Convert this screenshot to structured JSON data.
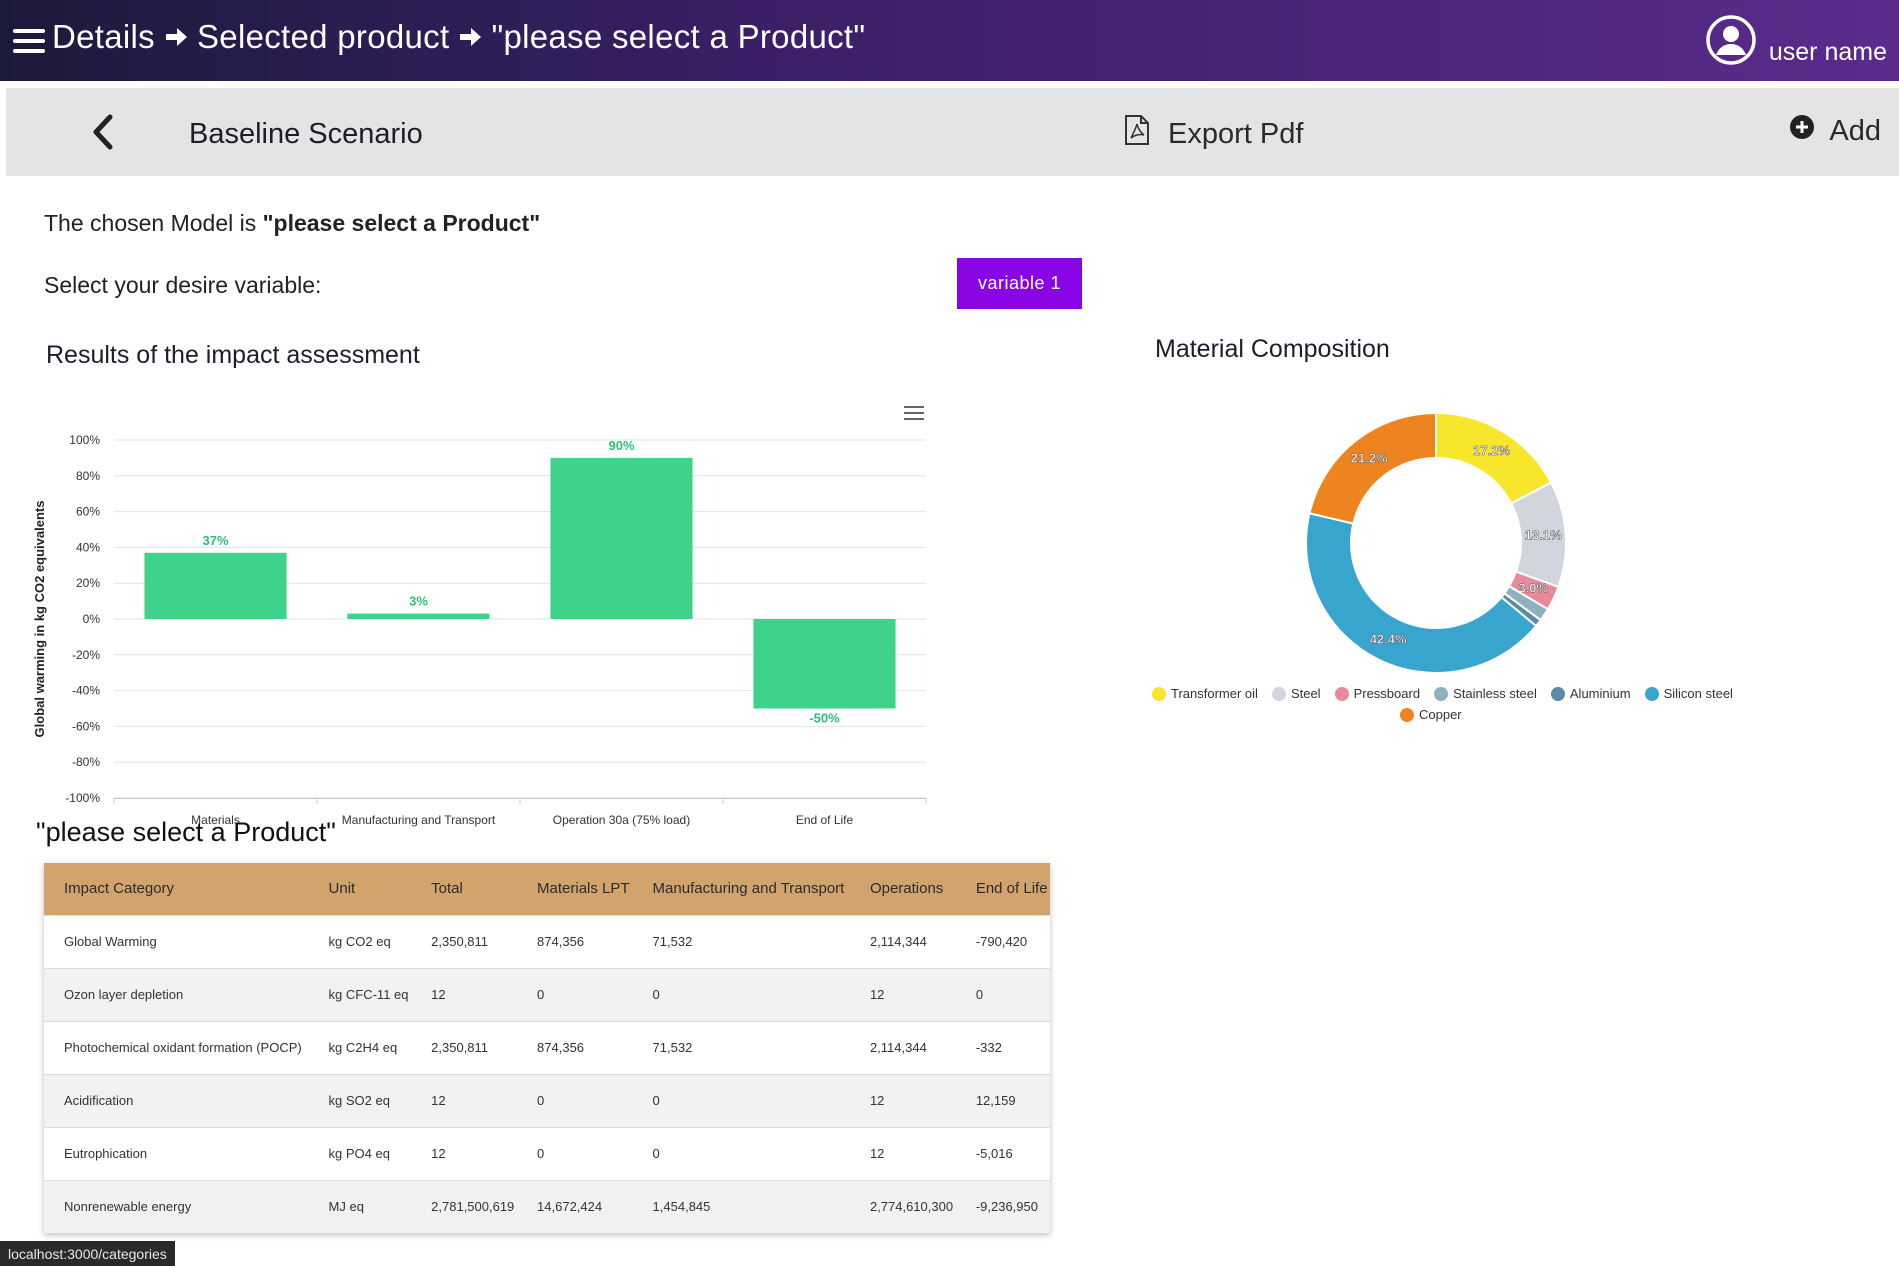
{
  "header": {
    "breadcrumbs": [
      "Details",
      "Selected product",
      "\"please select a Product\""
    ],
    "user_name": "user name"
  },
  "toolbar": {
    "title": "Baseline Scenario",
    "export_label": "Export Pdf",
    "add_label": "Add"
  },
  "content": {
    "model_prefix": "The chosen Model is ",
    "model_value": "\"please select a Product\"",
    "select_label": "Select your desire variable:",
    "variable_button": "variable 1",
    "impact_title": "Results of the impact assessment",
    "material_title": "Material Composition",
    "product_title": "\"please select a Product\""
  },
  "chart_data": [
    {
      "type": "bar",
      "title": "Results of the impact assessment",
      "ylabel": "Global warming in kg CO2 equivalents",
      "xlabel": "",
      "categories": [
        "Materials",
        "Manufacturing and Transport",
        "Operation 30a (75% load)",
        "End of Life"
      ],
      "values": [
        37,
        3,
        90,
        -50
      ],
      "data_labels": [
        "37%",
        "3%",
        "90%",
        "-50%"
      ],
      "ylim": [
        -100,
        100
      ],
      "yticks": [
        "100%",
        "80%",
        "60%",
        "40%",
        "20%",
        "0%",
        "-20%",
        "-40%",
        "-60%",
        "-80%",
        "-100%"
      ],
      "grid": true,
      "color": "#3fd28b"
    },
    {
      "type": "pie",
      "title": "Material Composition",
      "donut": true,
      "series": [
        {
          "name": "Transformer oil",
          "value": 17.2,
          "label": "17.2%",
          "color": "#f7e62b"
        },
        {
          "name": "Steel",
          "value": 13.1,
          "label": "13.1%",
          "color": "#d2d5de"
        },
        {
          "name": "Pressboard",
          "value": 3.0,
          "label": "3.0%",
          "color": "#e88a9a"
        },
        {
          "name": "Stainless steel",
          "value": 1.6,
          "label": "",
          "color": "#8fb0bd"
        },
        {
          "name": "Aluminium",
          "value": 0.9,
          "label": "",
          "color": "#5d88a6"
        },
        {
          "name": "Silicon steel",
          "value": 42.4,
          "label": "42.4%",
          "color": "#37a5cd"
        },
        {
          "name": "Copper",
          "value": 21.2,
          "label": "21.2%",
          "color": "#ee8420"
        }
      ],
      "legend_placement": "bottom"
    }
  ],
  "table": {
    "headers": [
      "Impact Category",
      "Unit",
      "Total",
      "Materials LPT",
      "Manufacturing and Transport",
      "Operations",
      "End of Life"
    ],
    "rows": [
      [
        "Global Warming",
        "kg CO2 eq",
        "2,350,811",
        "874,356",
        "71,532",
        "2,114,344",
        "-790,420"
      ],
      [
        "Ozon layer depletion",
        "kg CFC-11 eq",
        "12",
        "0",
        "0",
        "12",
        "0"
      ],
      [
        "Photochemical oxidant formation (POCP)",
        "kg C2H4 eq",
        "2,350,811",
        "874,356",
        "71,532",
        "2,114,344",
        "-332"
      ],
      [
        "Acidification",
        "kg SO2 eq",
        "12",
        "0",
        "0",
        "12",
        "12,159"
      ],
      [
        "Eutrophication",
        "kg PO4 eq",
        "12",
        "0",
        "0",
        "12",
        "-5,016"
      ],
      [
        "Nonrenewable energy",
        "MJ eq",
        "2,781,500,619",
        "14,672,424",
        "1,454,845",
        "2,774,610,300",
        "-9,236,950"
      ]
    ]
  },
  "status_bar": {
    "url": "localhost:3000/categories"
  }
}
